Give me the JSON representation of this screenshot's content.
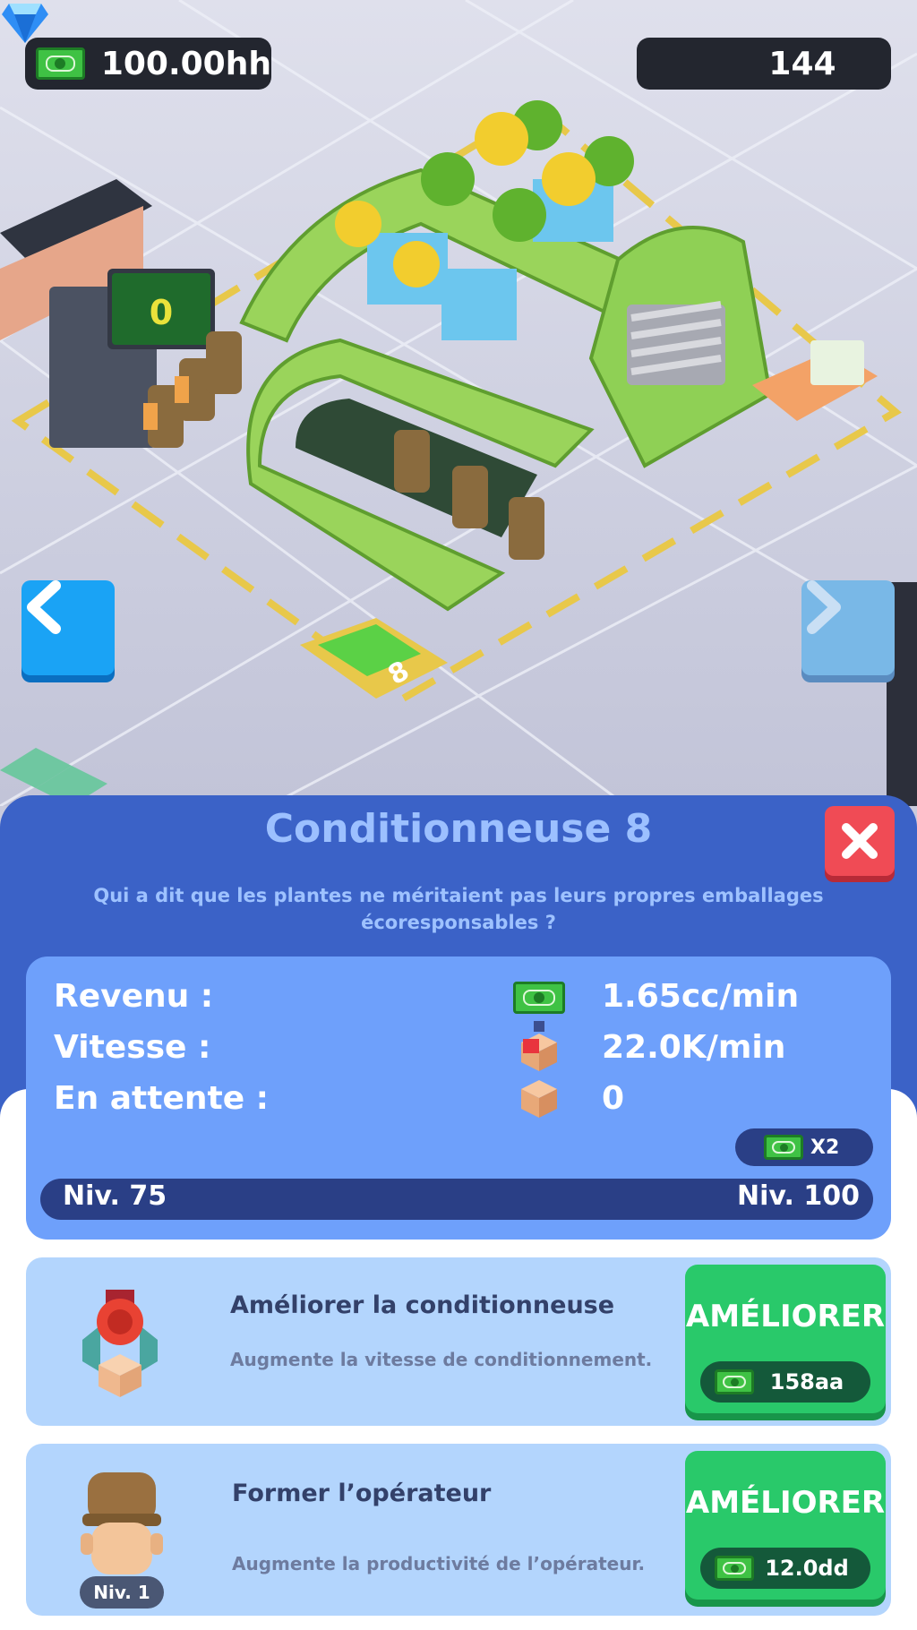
{
  "header": {
    "cash": "100.00hh",
    "gems": "144"
  },
  "scene": {
    "counter_display": "0",
    "station_number": "8"
  },
  "panel": {
    "title": "Conditionneuse 8",
    "description": "Qui a dit que les plantes ne méritaient pas leurs propres emballages écoresponsables ?",
    "stats": [
      {
        "label": "Revenu :",
        "value": "1.65cc/min",
        "icon": "cash-icon"
      },
      {
        "label": "Vitesse :",
        "value": "22.0K/min",
        "icon": "box-speed-icon"
      },
      {
        "label": "En attente :",
        "value": "0",
        "icon": "box-icon"
      }
    ],
    "boost": "X2",
    "level_current": "Niv. 75",
    "level_target": "Niv. 100",
    "level_progress": 0
  },
  "upgrades": [
    {
      "title": "Améliorer la conditionneuse",
      "description": "Augmente la vitesse de conditionnement.",
      "button": "AMÉLIORER",
      "price": "158aa",
      "icon": "packing-claw-icon"
    },
    {
      "title": "Former l’opérateur",
      "description": "Augmente la productivité de l’opérateur.",
      "button": "AMÉLIORER",
      "price": "12.0dd",
      "icon": "operator-avatar-icon",
      "level": "Niv. 1"
    }
  ],
  "colors": {
    "panel": "#3b62c7",
    "stats_box": "#6ea0fb",
    "button": "#29c96a",
    "close": "#f04b55"
  }
}
